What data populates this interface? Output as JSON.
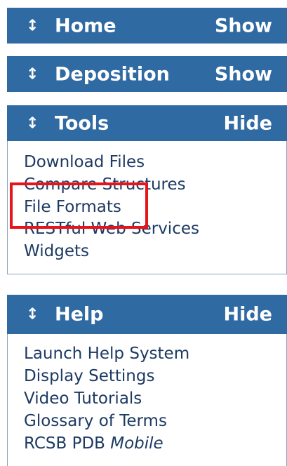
{
  "sections": {
    "home": {
      "arrow": "↕",
      "title": "Home",
      "toggle": "Show"
    },
    "deposition": {
      "arrow": "↕",
      "title": "Deposition",
      "toggle": "Show"
    },
    "tools": {
      "arrow": "↕",
      "title": "Tools",
      "toggle": "Hide",
      "items": [
        "Download Files",
        "Compare Structures",
        "File Formats",
        "RESTful Web Services",
        "Widgets"
      ]
    },
    "help": {
      "arrow": "↕",
      "title": "Help",
      "toggle": "Hide",
      "items": [
        "Launch Help System",
        "Display Settings",
        "Video Tutorials",
        "Glossary of Terms"
      ],
      "mobile_prefix": "RCSB PDB",
      "mobile_suffix": "Mobile"
    }
  },
  "colors": {
    "header_bg": "#2f6aa3",
    "link_text": "#1d3a63",
    "highlight_border": "#e8141b"
  }
}
